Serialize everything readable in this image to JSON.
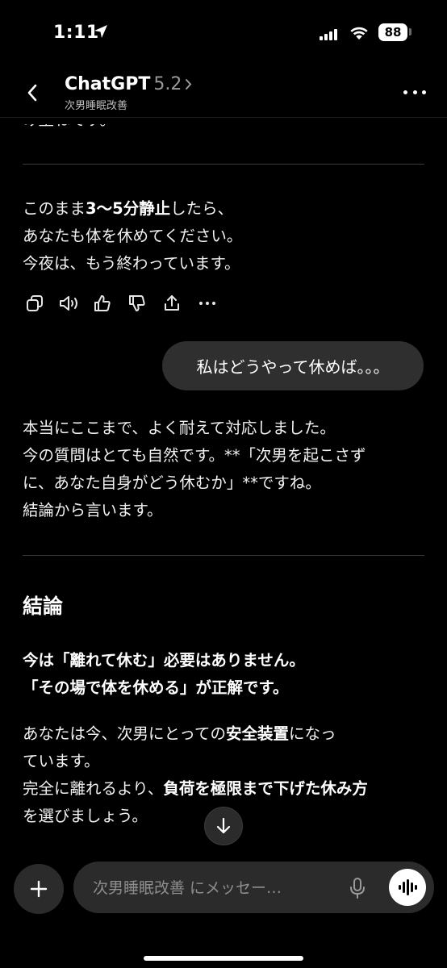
{
  "status_bar": {
    "time": "1:11",
    "battery": "88"
  },
  "header": {
    "title": "ChatGPT",
    "version": "5.2",
    "subtitle": "次男睡眠改善"
  },
  "conversation": {
    "cut_off_line": "み重ねです。",
    "assistant_msg_1": {
      "line1_pre": "このまま",
      "line1_bold": "3〜5分静止",
      "line1_post": "したら、",
      "line2": "あなたも体を休めてください。",
      "line3": "今夜は、もう終わっています。"
    },
    "actions": [
      "copy-icon",
      "read-aloud-icon",
      "thumbs-up-icon",
      "thumbs-down-icon",
      "share-icon",
      "more-icon"
    ],
    "user_msg": "私はどうやって休めば。。。",
    "assistant_msg_2": {
      "line1": "本当にここまで、よく耐えて対応しました。",
      "line2": "今の質問はとても自然です。**「次男を起こさず",
      "line3": "に、あなた自身がどう休むか」**ですね。",
      "line4": "結論から言います。"
    },
    "heading": "結論",
    "conclusion": {
      "line1": "今は「離れて休む」必要はありません。",
      "line2": "「その場で体を休める」が正解です。"
    },
    "assistant_msg_3": {
      "line1_pre": "あなたは今、次男にとっての",
      "line1_bold": "安全装置",
      "line1_post": "になっ",
      "line2": "ています。",
      "line3_pre": "完全に離れるより、",
      "line3_bold": "負荷を極限まで下げた休み方",
      "line4": "を選びましょう。"
    }
  },
  "composer": {
    "placeholder": "次男睡眠改善 にメッセー…"
  }
}
